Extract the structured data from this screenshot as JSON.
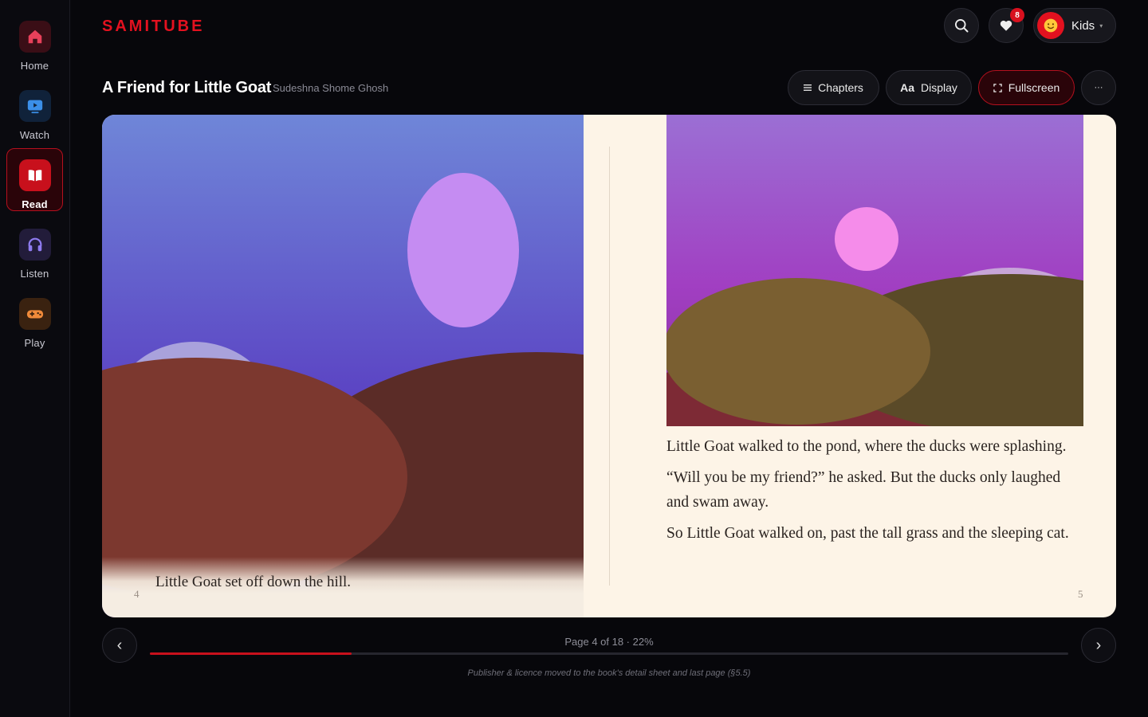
{
  "app": {
    "logo": "SAMITUBE"
  },
  "sidebar": {
    "items": [
      {
        "label": "Home",
        "icon": "home-icon",
        "color": "#e8405a"
      },
      {
        "label": "Watch",
        "icon": "play-screen-icon",
        "color": "#3b8fe8"
      },
      {
        "label": "Read",
        "icon": "open-book-icon",
        "color": "#ffffff",
        "active": true
      },
      {
        "label": "Listen",
        "icon": "headphones-icon",
        "color": "#8f7cf0"
      },
      {
        "label": "Play",
        "icon": "gamepad-icon",
        "color": "#f08a3a"
      }
    ]
  },
  "header": {
    "notifications_count": "8",
    "profile_name": "Kids"
  },
  "book": {
    "title": "A Friend for Little Goat",
    "author": "Sudeshna Shome Ghosh",
    "toolbar": {
      "chapters": "Chapters",
      "display_prefix": "Aa",
      "display": "Display",
      "fullscreen": "Fullscreen",
      "more": "···"
    },
    "left_page": {
      "number": "4",
      "text": "Little Goat set off down the hill."
    },
    "right_page": {
      "number": "5",
      "paragraphs": [
        "Little Goat walked to the pond, where the ducks were splashing.",
        "“Will you be my friend?” he asked. But the ducks only laughed and swam away.",
        "So Little Goat walked on, past the tall grass and the sleeping cat."
      ]
    }
  },
  "progress": {
    "label": "Page 4 of 18 · 22%",
    "fraction": 0.22,
    "prev": "‹",
    "next": "›"
  },
  "footnote": "Publisher & licence moved to the book's detail sheet and last page (§5.5)",
  "colors": {
    "accent": "#e3111f",
    "paper": "#fdf4e7"
  }
}
